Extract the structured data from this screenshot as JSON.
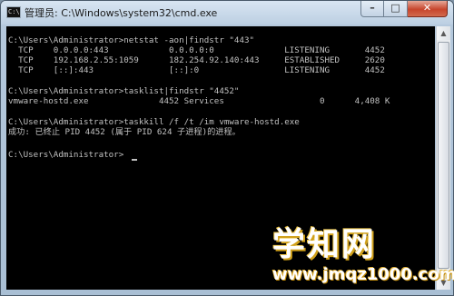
{
  "window": {
    "icon_text": "C:\\",
    "title": "管理员: C:\\Windows\\system32\\cmd.exe",
    "min_label": "–",
    "max_label": "□",
    "close_label": "✕"
  },
  "console": {
    "lines": [
      "C:\\Users\\Administrator>netstat -aon|findstr \"443\"",
      "  TCP    0.0.0.0:443            0.0.0.0:0              LISTENING       4452",
      "  TCP    192.168.2.55:1059      182.254.92.140:443     ESTABLISHED     2620",
      "  TCP    [::]:443               [::]:0                 LISTENING       4452",
      "",
      "C:\\Users\\Administrator>tasklist|findstr \"4452\"",
      "vmware-hostd.exe              4452 Services                   0      4,408 K",
      "",
      "C:\\Users\\Administrator>taskkill /f /t /im vmware-hostd.exe",
      "成功: 已终止 PID 4452 (属于 PID 624 子进程)的进程。",
      "",
      "C:\\Users\\Administrator>"
    ]
  },
  "watermark": {
    "title": "学知网",
    "url": "www.jmqz1000.com"
  },
  "colors": {
    "console_bg": "#000000",
    "console_text": "#c0c0c0",
    "title_bar": "#c9d8e8",
    "close_button": "#c7452c"
  },
  "icons": {
    "app": "cmd-icon",
    "minimize": "minimize-icon",
    "maximize": "maximize-icon",
    "close": "close-icon",
    "scroll_up": "arrow-up-icon",
    "scroll_down": "arrow-down-icon"
  }
}
